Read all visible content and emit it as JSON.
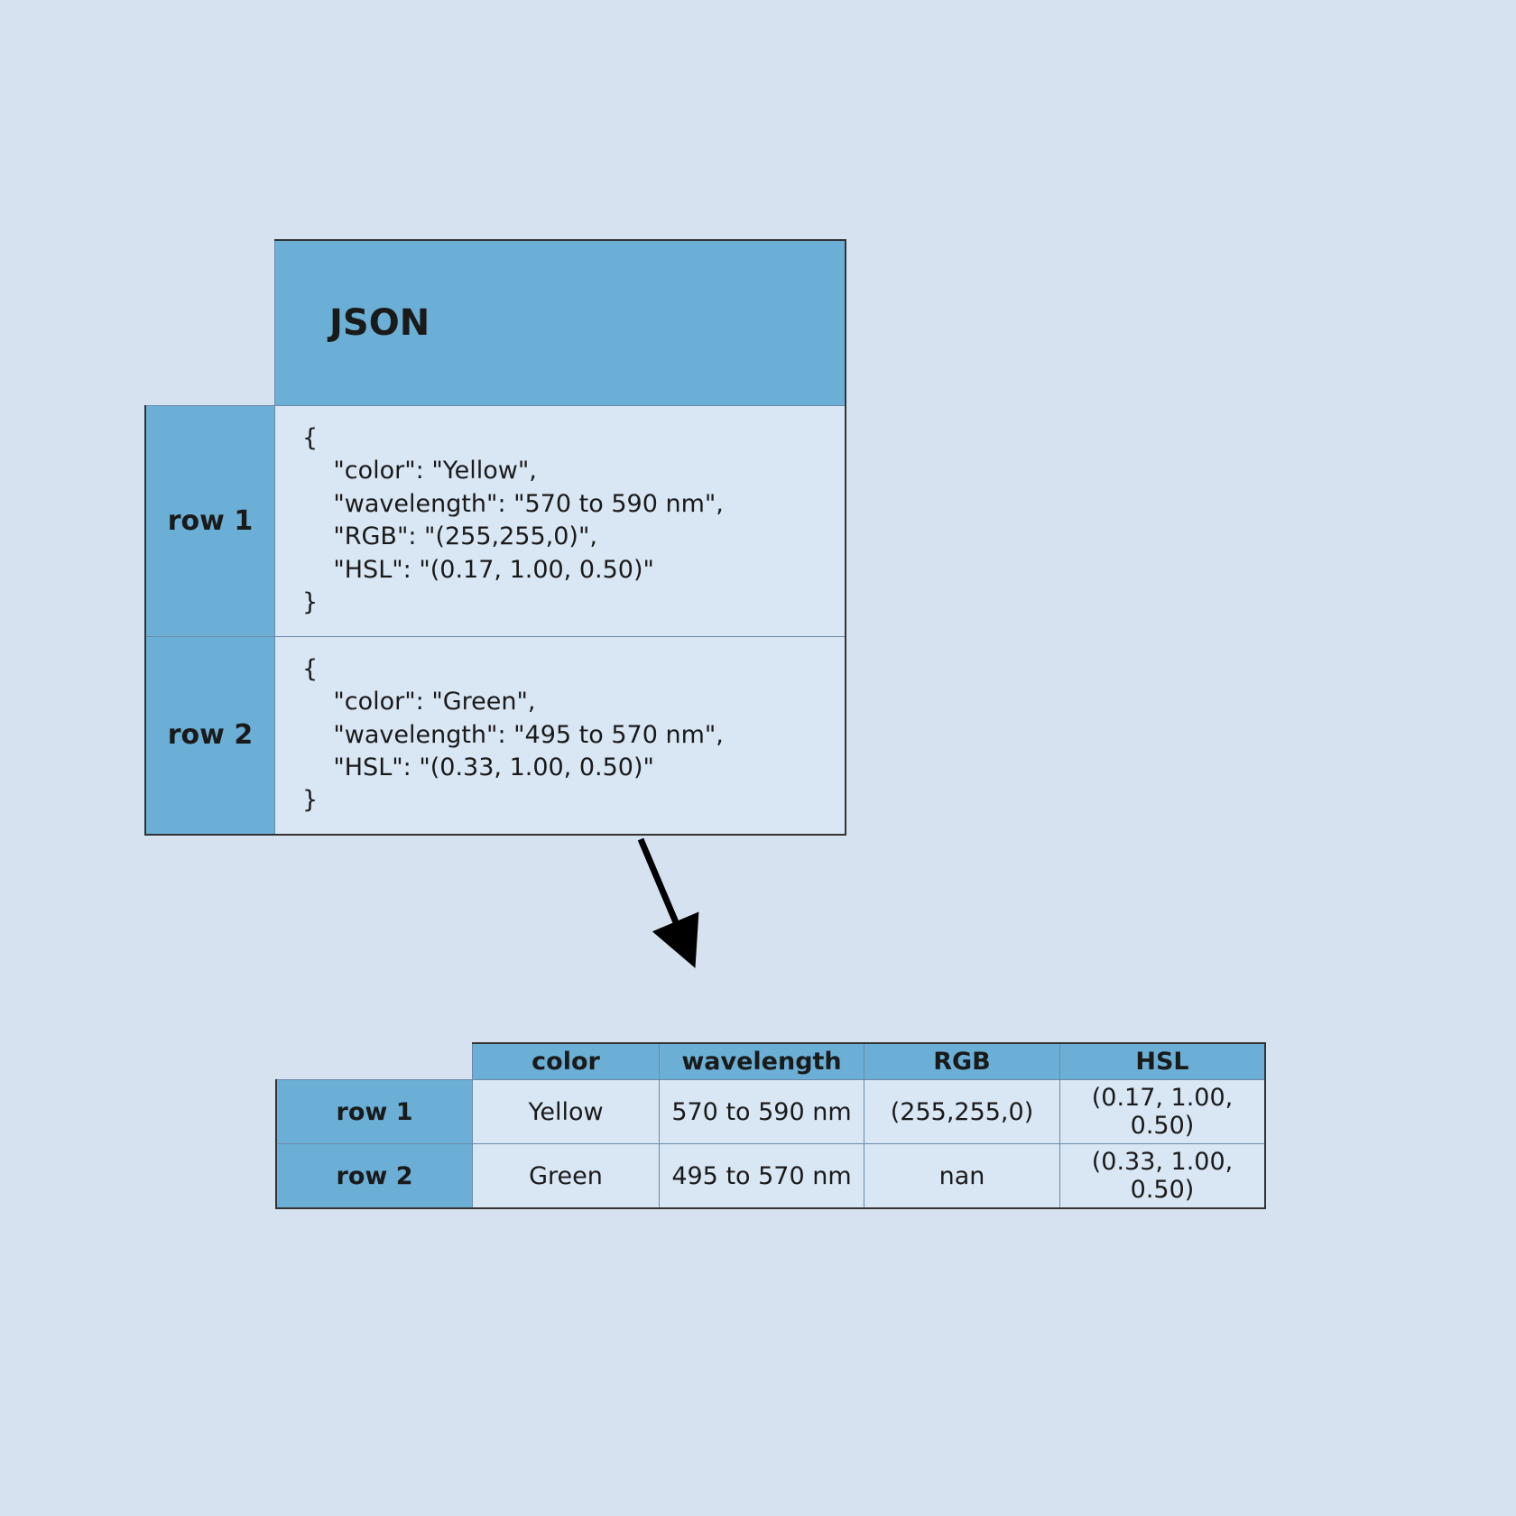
{
  "json_table": {
    "header": "JSON",
    "rows": [
      {
        "label": "row 1",
        "text": "{\n    \"color\": \"Yellow\",\n    \"wavelength\": \"570 to 590 nm\",\n    \"RGB\": \"(255,255,0)\",\n    \"HSL\": \"(0.17, 1.00, 0.50)\"\n}"
      },
      {
        "label": "row 2",
        "text": "{\n    \"color\": \"Green\",\n    \"wavelength\": \"495 to 570 nm\",\n    \"HSL\": \"(0.33, 1.00, 0.50)\"\n}"
      }
    ]
  },
  "result_table": {
    "columns": [
      "color",
      "wavelength",
      "RGB",
      "HSL"
    ],
    "rows": [
      {
        "label": "row 1",
        "cells": [
          "Yellow",
          "570 to 590 nm",
          "(255,255,0)",
          "(0.17, 1.00, 0.50)"
        ]
      },
      {
        "label": "row 2",
        "cells": [
          "Green",
          "495 to 570 nm",
          "nan",
          "(0.33, 1.00, 0.50)"
        ]
      }
    ]
  },
  "chart_data": {
    "type": "table",
    "title": "JSON rows normalized into a tabular DataFrame",
    "input": [
      {
        "color": "Yellow",
        "wavelength": "570 to 590 nm",
        "RGB": "(255,255,0)",
        "HSL": "(0.17, 1.00, 0.50)"
      },
      {
        "color": "Green",
        "wavelength": "495 to 570 nm",
        "HSL": "(0.33, 1.00, 0.50)"
      }
    ],
    "output": {
      "columns": [
        "color",
        "wavelength",
        "RGB",
        "HSL"
      ],
      "index": [
        "row 1",
        "row 2"
      ],
      "data": [
        [
          "Yellow",
          "570 to 590 nm",
          "(255,255,0)",
          "(0.17, 1.00, 0.50)"
        ],
        [
          "Green",
          "495 to 570 nm",
          "nan",
          "(0.33, 1.00, 0.50)"
        ]
      ]
    }
  }
}
